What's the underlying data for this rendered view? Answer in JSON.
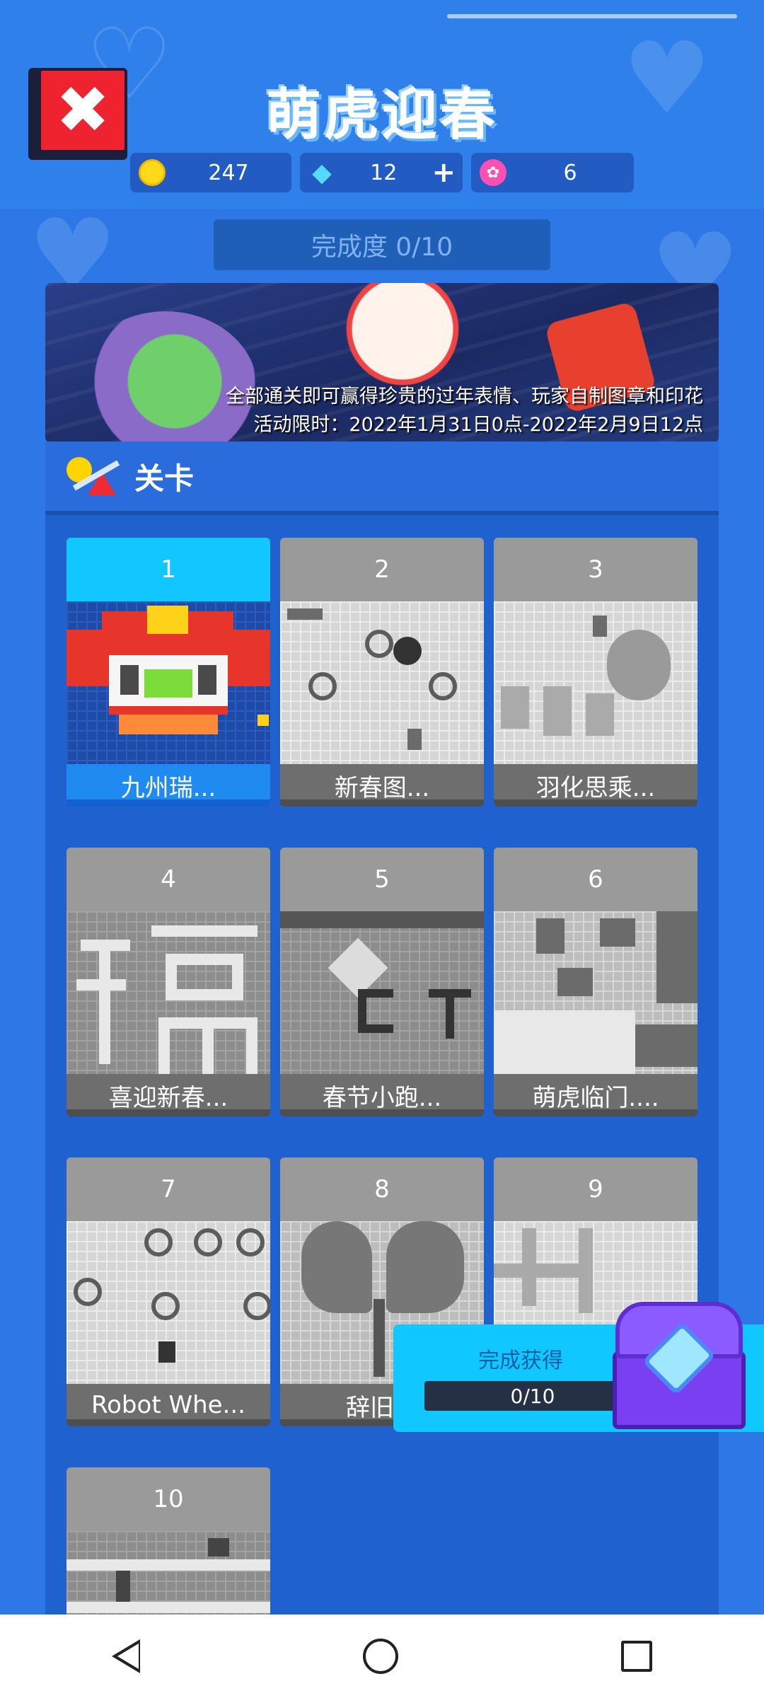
{
  "header": {
    "title": "萌虎迎春",
    "close_label": "✖",
    "currencies": [
      {
        "icon": "coin-icon",
        "value": "247"
      },
      {
        "icon": "diamond-icon",
        "value": "12",
        "add_label": "+"
      },
      {
        "icon": "lotus-icon",
        "value": "6"
      }
    ]
  },
  "progress": {
    "label": "完成度 0/10"
  },
  "banner": {
    "line1": "全部通关即可赢得珍贵的过年表情、玩家自制图章和印花",
    "line2": "活动限时：2022年1月31日0点-2022年2月9日12点"
  },
  "section": {
    "title": "关卡"
  },
  "levels": [
    {
      "num": "1",
      "name": "九州瑞...",
      "state": "active"
    },
    {
      "num": "2",
      "name": "新春图...",
      "state": "locked"
    },
    {
      "num": "3",
      "name": "羽化思乘...",
      "state": "locked"
    },
    {
      "num": "4",
      "name": "喜迎新春...",
      "state": "locked"
    },
    {
      "num": "5",
      "name": "春节小跑...",
      "state": "locked"
    },
    {
      "num": "6",
      "name": "萌虎临门....",
      "state": "locked"
    },
    {
      "num": "7",
      "name": "Robot Whe...",
      "state": "locked"
    },
    {
      "num": "8",
      "name": "辞旧迎",
      "state": "locked"
    },
    {
      "num": "9",
      "name": "",
      "state": "locked"
    },
    {
      "num": "10",
      "name": "",
      "state": "locked"
    }
  ],
  "reward": {
    "title": "完成获得",
    "progress": "0/10"
  },
  "colors": {
    "background": "#2d77e6",
    "panel": "#1f62cf",
    "accent": "#12c7ff",
    "close": "#ef2230"
  }
}
